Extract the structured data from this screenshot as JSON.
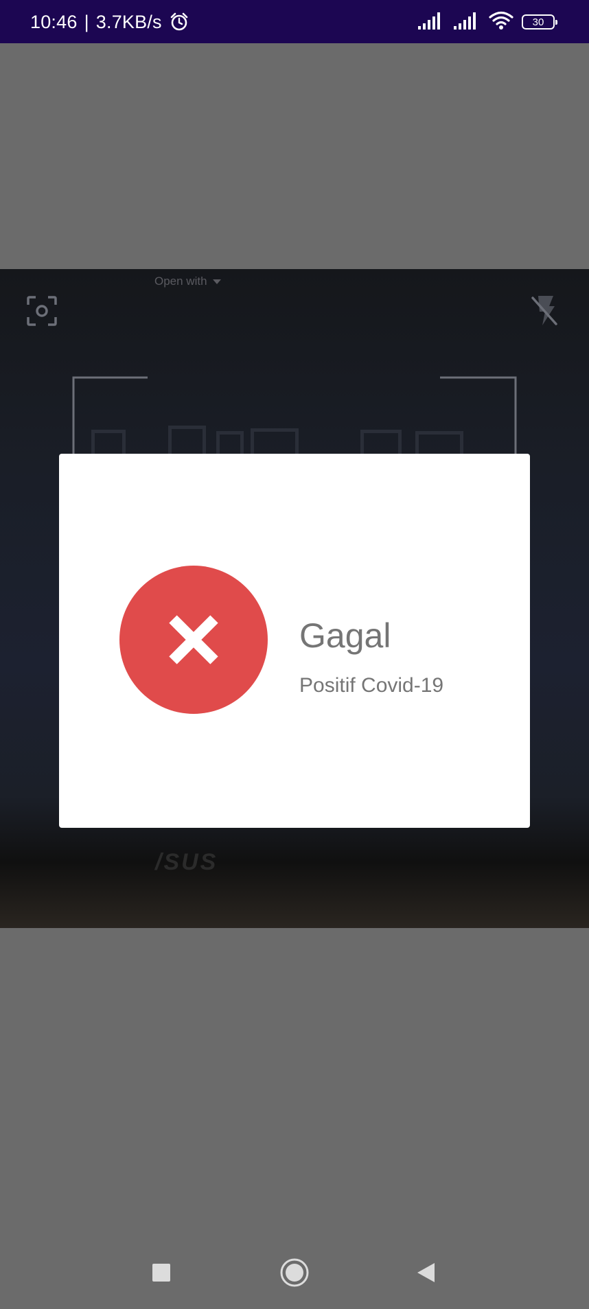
{
  "status_bar": {
    "time": "10:46",
    "separator": "|",
    "network_speed": "3.7KB/s",
    "battery_level": "30",
    "icons": [
      "alarm-icon",
      "signal-icon",
      "signal-icon",
      "wifi-icon",
      "battery-icon"
    ]
  },
  "scanner": {
    "open_with_label": "Open with",
    "laptop_brand": "/SUS"
  },
  "dialog": {
    "title": "Gagal",
    "message": "Positif Covid-19",
    "icon": "close-icon",
    "icon_color": "#e04b4b"
  },
  "nav_bar": {
    "buttons": [
      "recents-button",
      "home-button",
      "back-button"
    ]
  },
  "colors": {
    "status_bar": "#1c0652",
    "scrim": "#6b6b6b",
    "error": "#e04b4b",
    "text": "#757575"
  }
}
